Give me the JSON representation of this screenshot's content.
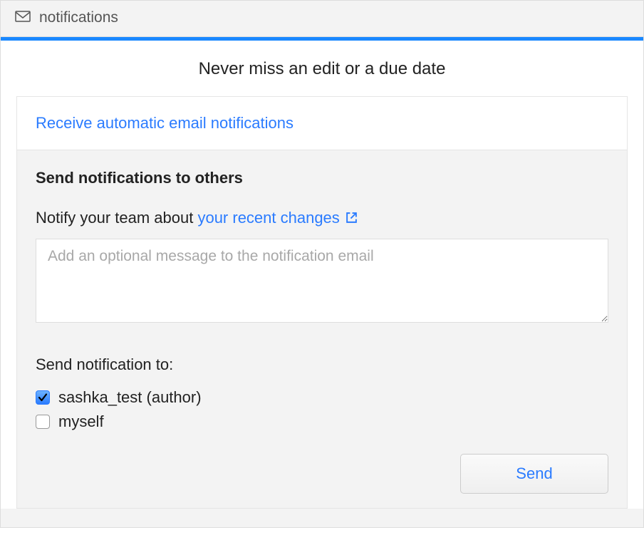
{
  "header": {
    "title": "notifications"
  },
  "main": {
    "heading": "Never miss an edit or a due date",
    "auto_link": "Receive automatic email notifications",
    "section_title": "Send notifications to others",
    "notify_prefix": "Notify your team about ",
    "notify_link": "your recent changes",
    "message_placeholder": "Add an optional message to the notification email",
    "send_to_label": "Send notification to:",
    "recipients": [
      {
        "label": "sashka_test (author)",
        "checked": true
      },
      {
        "label": "myself",
        "checked": false
      }
    ],
    "send_button": "Send"
  }
}
